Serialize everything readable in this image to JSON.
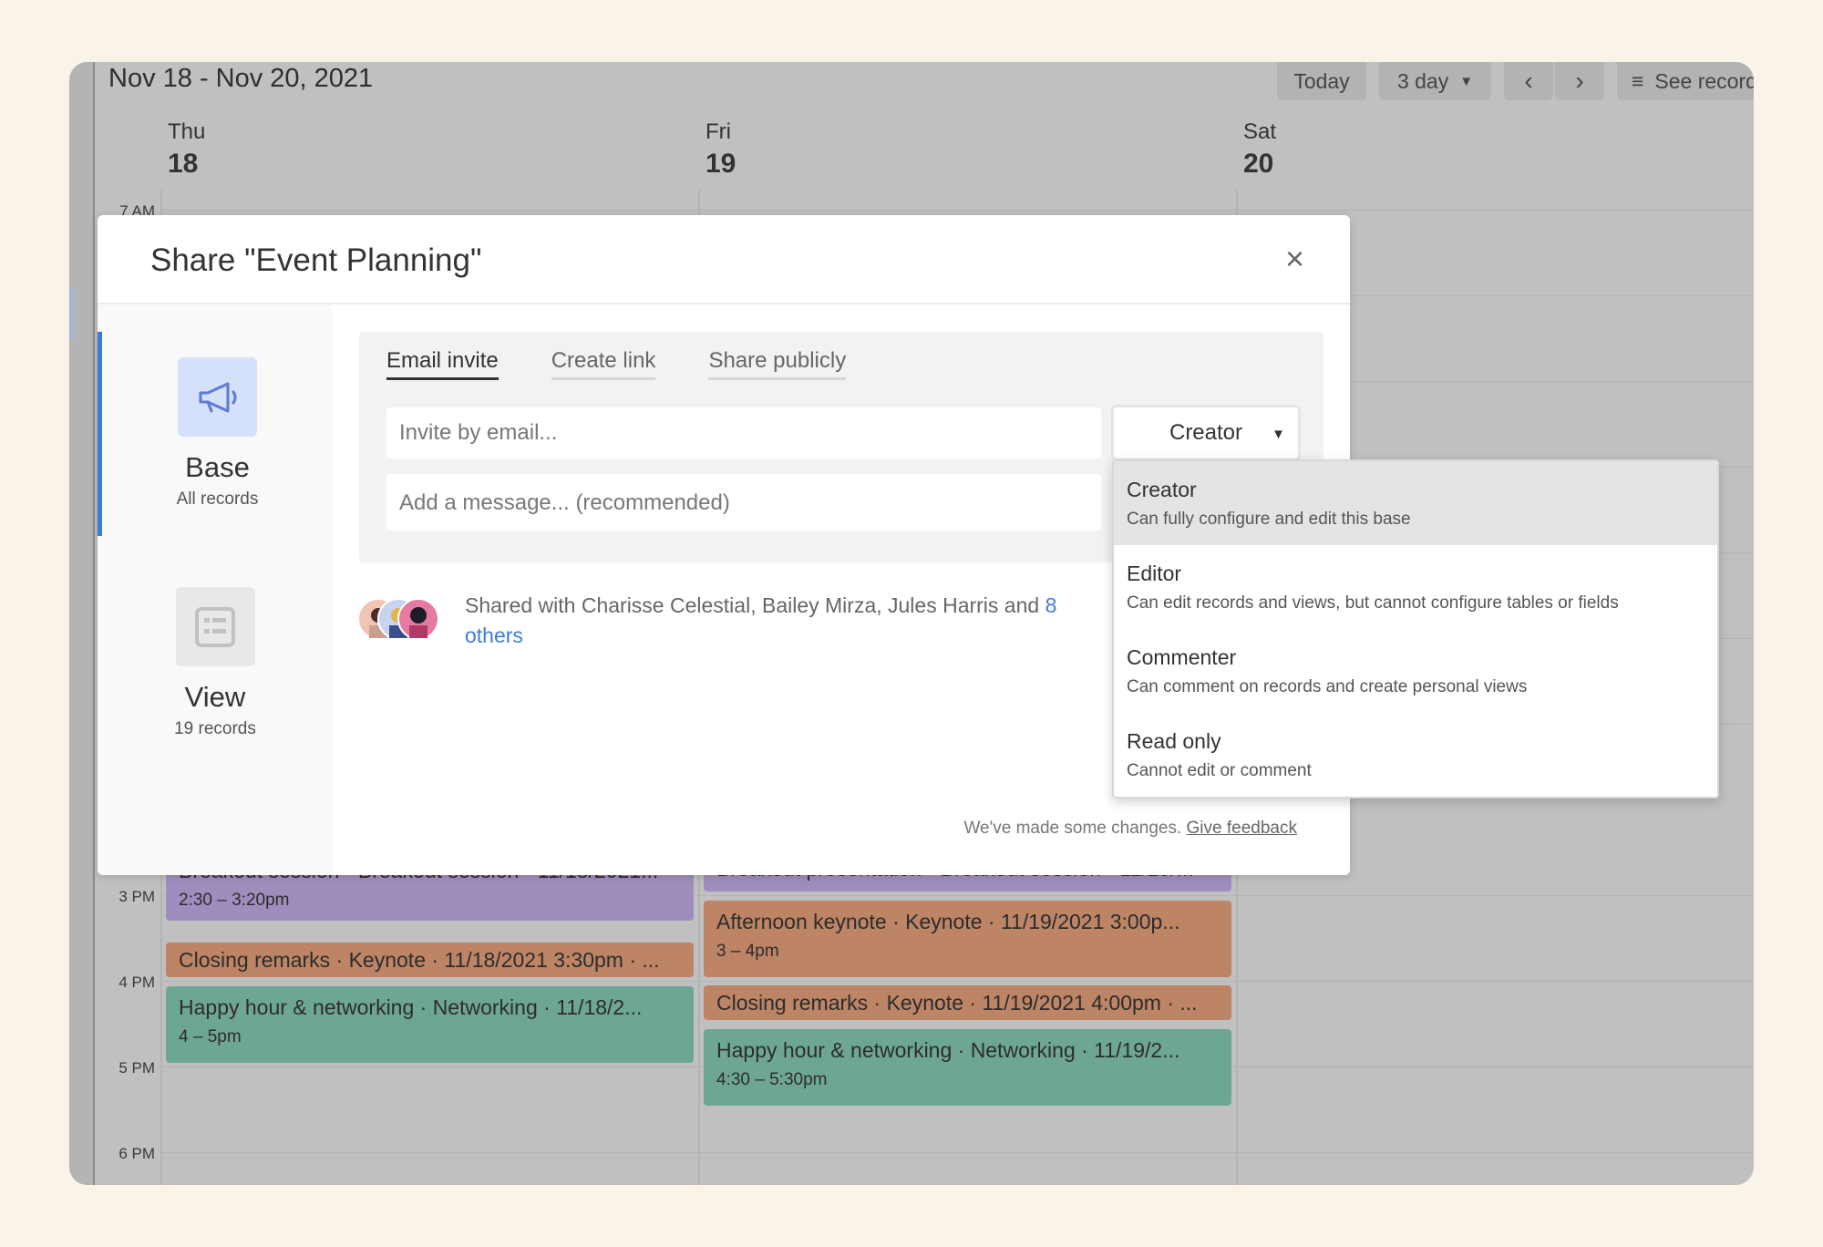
{
  "calendar": {
    "title": "Nov 18 - Nov 20, 2021",
    "toolbar": {
      "today": "Today",
      "range": "3 day",
      "see_records": "See records"
    },
    "days": [
      {
        "name": "Thu",
        "num": "18"
      },
      {
        "name": "Fri",
        "num": "19"
      },
      {
        "name": "Sat",
        "num": "20"
      }
    ],
    "hours": [
      "7 AM",
      "3 PM",
      "4 PM",
      "5 PM",
      "6 PM"
    ],
    "events": [
      {
        "title": "Breakout session · Breakout session · 11/18/2021...",
        "time": "2:30 – 3:20pm"
      },
      {
        "title": "Closing remarks · Keynote · 11/18/2021 3:30pm · ...",
        "time": ""
      },
      {
        "title": "Happy hour & networking · Networking · 11/18/2...",
        "time": "4 – 5pm"
      },
      {
        "title": "Breakout presentation · Breakout session · 11/19/...",
        "time": ""
      },
      {
        "title": "Afternoon keynote · Keynote · 11/19/2021 3:00p...",
        "time": "3 – 4pm"
      },
      {
        "title": "Closing remarks · Keynote · 11/19/2021 4:00pm · ...",
        "time": ""
      },
      {
        "title": "Happy hour & networking · Networking · 11/19/2...",
        "time": "4:30 – 5:30pm"
      }
    ]
  },
  "modal": {
    "title": "Share \"Event Planning\"",
    "close": "×",
    "sidebar": [
      {
        "label": "Base",
        "sub": "All records"
      },
      {
        "label": "View",
        "sub": "19 records"
      }
    ],
    "tabs": [
      "Email invite",
      "Create link",
      "Share publicly"
    ],
    "email_placeholder": "Invite by email...",
    "message_placeholder": "Add a message... (recommended)",
    "role_value": "Creator",
    "shared_prefix": "Shared with Charisse Celestial, Bailey Mirza, Jules Harris and ",
    "shared_link": "8 others",
    "feedback_text": "We've made some changes. ",
    "feedback_link": "Give feedback"
  },
  "role_dropdown": [
    {
      "label": "Creator",
      "desc": "Can fully configure and edit this base"
    },
    {
      "label": "Editor",
      "desc": "Can edit records and views, but cannot configure tables or fields"
    },
    {
      "label": "Commenter",
      "desc": "Can comment on records and create personal views"
    },
    {
      "label": "Read only",
      "desc": "Cannot edit or comment"
    }
  ],
  "colors": {
    "accent": "#3f7bd9",
    "event_purple": "#9f8ebd",
    "event_orange": "#bd8466",
    "event_green": "#6ea694"
  }
}
